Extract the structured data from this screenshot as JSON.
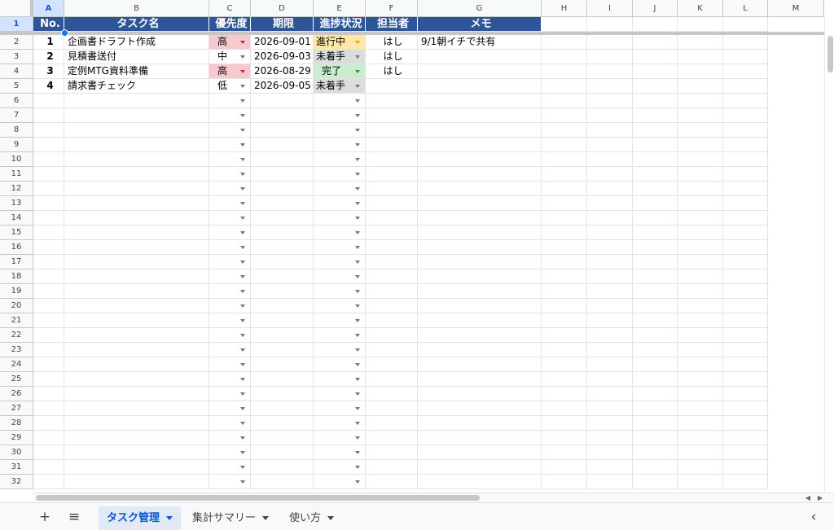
{
  "column_letters": [
    "A",
    "B",
    "C",
    "D",
    "E",
    "F",
    "G",
    "H",
    "I",
    "J",
    "K",
    "L",
    "M"
  ],
  "header_row": [
    "No.",
    "タスク名",
    "優先度",
    "期限",
    "進捗状況",
    "担当者",
    "メモ"
  ],
  "tasks": [
    {
      "no": "1",
      "name": "企画書ドラフト作成",
      "priority": "高",
      "due": "2026-09-01",
      "status": "進行中",
      "assignee": "はし",
      "memo": "9/1朝イチで共有"
    },
    {
      "no": "2",
      "name": "見積書送付",
      "priority": "中",
      "due": "2026-09-03",
      "status": "未着手",
      "assignee": "はし",
      "memo": ""
    },
    {
      "no": "3",
      "name": "定例MTG資料準備",
      "priority": "高",
      "due": "2026-08-29",
      "status": "完了",
      "assignee": "はし",
      "memo": ""
    },
    {
      "no": "4",
      "name": "請求書チェック",
      "priority": "低",
      "due": "2026-09-05",
      "status": "未着手",
      "assignee": "",
      "memo": ""
    }
  ],
  "visible_row_count": 32,
  "colors": {
    "header_bg": "#2e5597",
    "priority_high": "#f6c9cf",
    "status_in_progress": "#fde8a6",
    "status_not_started": "#dcdcdc",
    "status_done": "#c9eecf",
    "arrow_high": "#d4213d",
    "arrow_in_progress": "#d9a800",
    "arrow_done": "#1e9e45",
    "arrow_neutral": "#777777"
  },
  "sheet_tabs": [
    {
      "label": "タスク管理",
      "active": true
    },
    {
      "label": "集計サマリー",
      "active": false
    },
    {
      "label": "使い方",
      "active": false
    }
  ],
  "toolbar": {
    "add_icon": "+",
    "menu_icon": "≡",
    "collapse_icon": "‹"
  }
}
